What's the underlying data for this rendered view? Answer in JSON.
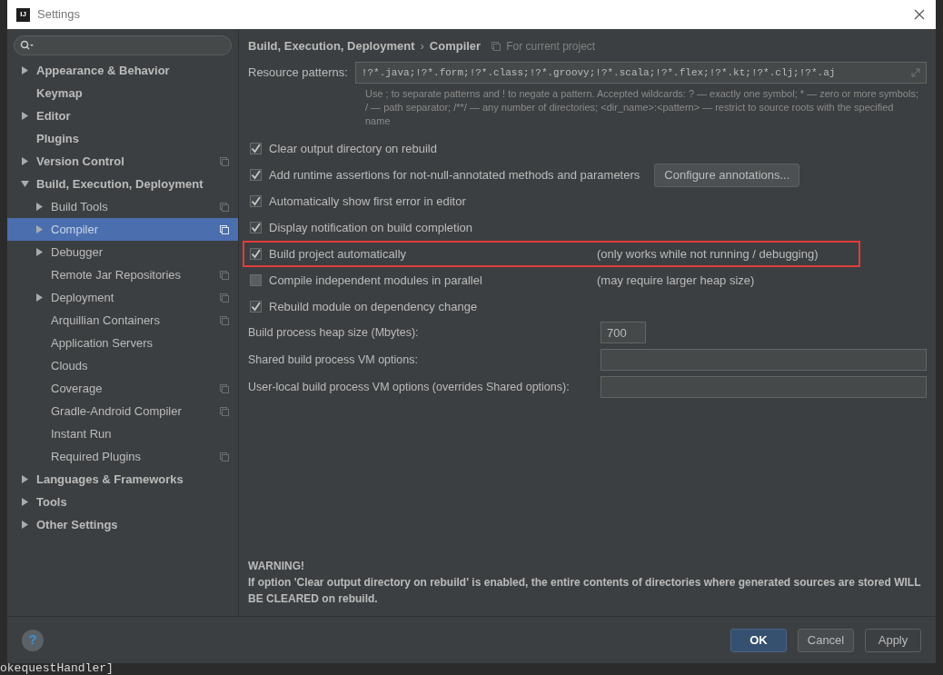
{
  "window": {
    "title": "Settings",
    "logo": "IJ"
  },
  "sidebar": {
    "items": [
      {
        "label": "Appearance & Behavior",
        "expanded": false,
        "selected": false,
        "project_scope": false
      },
      {
        "label": "Keymap",
        "selected": false,
        "project_scope": false
      },
      {
        "label": "Editor",
        "expanded": false,
        "selected": false,
        "project_scope": false
      },
      {
        "label": "Plugins",
        "selected": false,
        "project_scope": false
      },
      {
        "label": "Version Control",
        "expanded": false,
        "selected": false,
        "project_scope": true
      },
      {
        "label": "Build, Execution, Deployment",
        "expanded": true,
        "selected": false,
        "project_scope": false,
        "children": [
          {
            "label": "Build Tools",
            "expanded": false,
            "selected": false,
            "project_scope": true
          },
          {
            "label": "Compiler",
            "expanded": false,
            "selected": true,
            "project_scope": true
          },
          {
            "label": "Debugger",
            "expanded": false,
            "selected": false,
            "project_scope": false
          },
          {
            "label": "Remote Jar Repositories",
            "selected": false,
            "project_scope": true
          },
          {
            "label": "Deployment",
            "expanded": false,
            "selected": false,
            "project_scope": true
          },
          {
            "label": "Arquillian Containers",
            "selected": false,
            "project_scope": true
          },
          {
            "label": "Application Servers",
            "selected": false,
            "project_scope": false
          },
          {
            "label": "Clouds",
            "selected": false,
            "project_scope": false
          },
          {
            "label": "Coverage",
            "selected": false,
            "project_scope": true
          },
          {
            "label": "Gradle-Android Compiler",
            "selected": false,
            "project_scope": true
          },
          {
            "label": "Instant Run",
            "selected": false,
            "project_scope": false
          },
          {
            "label": "Required Plugins",
            "selected": false,
            "project_scope": true
          }
        ]
      },
      {
        "label": "Languages & Frameworks",
        "expanded": false,
        "selected": false,
        "project_scope": false
      },
      {
        "label": "Tools",
        "expanded": false,
        "selected": false,
        "project_scope": false
      },
      {
        "label": "Other Settings",
        "expanded": false,
        "selected": false,
        "project_scope": false
      }
    ]
  },
  "breadcrumb": {
    "parent": "Build, Execution, Deployment",
    "separator": "›",
    "current": "Compiler",
    "scope": "For current project"
  },
  "resource_patterns": {
    "label": "Resource patterns:",
    "value": "!?*.java;!?*.form;!?*.class;!?*.groovy;!?*.scala;!?*.flex;!?*.kt;!?*.clj;!?*.aj",
    "hint": "Use ; to separate patterns and ! to negate a pattern. Accepted wildcards: ? — exactly one symbol; * — zero or more symbols; / — path separator; /**/ — any number of directories; <dir_name>:<pattern> — restrict to source roots with the specified name"
  },
  "options": [
    {
      "label": "Clear output directory on rebuild",
      "checked": true,
      "highlighted": false
    },
    {
      "label": "Add runtime assertions for not-null-annotated methods and parameters",
      "checked": true,
      "highlighted": false,
      "button": "Configure annotations..."
    },
    {
      "label": "Automatically show first error in editor",
      "checked": true,
      "highlighted": false
    },
    {
      "label": "Display notification on build completion",
      "checked": true,
      "highlighted": false
    },
    {
      "label": "Build project automatically",
      "checked": true,
      "highlighted": true,
      "note": "(only works while not running / debugging)"
    },
    {
      "label": "Compile independent modules in parallel",
      "checked": false,
      "highlighted": false,
      "note": "(may require larger heap size)"
    },
    {
      "label": "Rebuild module on dependency change",
      "checked": true,
      "highlighted": false
    }
  ],
  "fields": [
    {
      "label": "Build process heap size (Mbytes):",
      "value": "700",
      "kind": "short"
    },
    {
      "label": "Shared build process VM options:",
      "kind": "wide"
    },
    {
      "label": "User-local build process VM options (overrides Shared options):",
      "kind": "wide"
    }
  ],
  "warning": {
    "title": "WARNING!",
    "text": "If option 'Clear output directory on rebuild' is enabled, the entire contents of directories where generated sources are stored WILL BE CLEARED on rebuild."
  },
  "help": {
    "label": "?"
  },
  "buttons": [
    {
      "label": "OK",
      "kind": "default",
      "disabled": false
    },
    {
      "label": "Cancel",
      "kind": "normal",
      "disabled": false
    },
    {
      "label": "Apply",
      "kind": "normal",
      "disabled": true
    }
  ],
  "background_console": {
    "text": "okequestHandler]"
  }
}
